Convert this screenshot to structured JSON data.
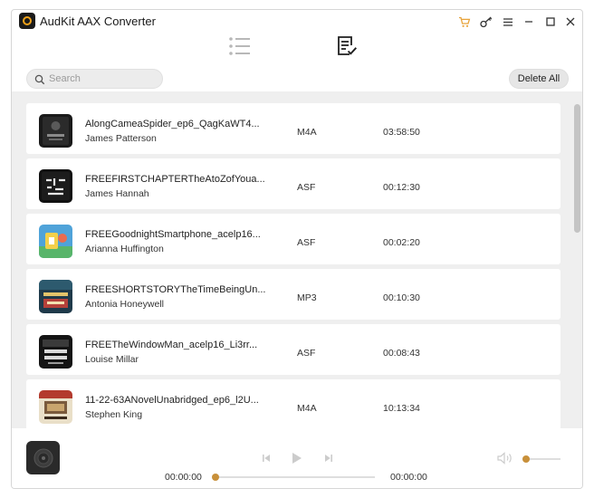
{
  "app": {
    "title": "AudKit AAX Converter"
  },
  "colors": {
    "accent": "#c8903a",
    "cart": "#e8a33a",
    "list_bg": "#efefef"
  },
  "icons": {
    "title_bar": [
      "cart-icon",
      "key-icon",
      "menu-icon",
      "minimize-icon",
      "maximize-icon",
      "close-icon"
    ],
    "modes": [
      "converting-list-icon",
      "converted-history-icon"
    ]
  },
  "toolbar": {
    "search_placeholder": "Search",
    "search_value": "",
    "delete_all_label": "Delete All"
  },
  "items": [
    {
      "title": "AlongCameaSpider_ep6_QagKaWT4...",
      "author": "James Patterson",
      "format": "M4A",
      "duration": "03:58:50"
    },
    {
      "title": "FREEFIRSTCHAPTERTheAtoZofYoua...",
      "author": "James Hannah",
      "format": "ASF",
      "duration": "00:12:30"
    },
    {
      "title": "FREEGoodnightSmartphone_acelp16...",
      "author": "Arianna Huffington",
      "format": "ASF",
      "duration": "00:02:20"
    },
    {
      "title": "FREESHORTSTORYTheTimeBeingUn...",
      "author": "Antonia Honeywell",
      "format": "MP3",
      "duration": "00:10:30"
    },
    {
      "title": "FREETheWindowMan_acelp16_Li3rr...",
      "author": "Louise Millar",
      "format": "ASF",
      "duration": "00:08:43"
    },
    {
      "title": "11-22-63ANovelUnabridged_ep6_l2U...",
      "author": "Stephen King",
      "format": "M4A",
      "duration": "10:13:34"
    }
  ],
  "player": {
    "current_time": "00:00:00",
    "total_time": "00:00:00",
    "progress": 0,
    "volume": 0
  }
}
